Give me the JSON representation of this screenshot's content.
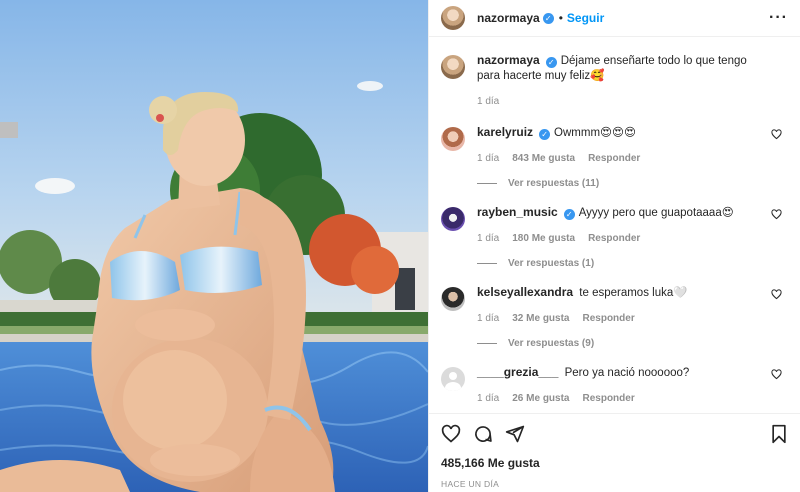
{
  "header": {
    "username": "nazormaya",
    "separator": "•",
    "follow_label": "Seguir",
    "more_label": "···"
  },
  "caption": {
    "username": "nazormaya",
    "text": "Déjame enseñarte todo lo que tengo para hacerte muy feliz🥰",
    "time": "1 día"
  },
  "comments": [
    {
      "username": "karelyruiz",
      "verified": true,
      "text": "Owmmm😍😍😍",
      "time": "1 día",
      "likes": "843 Me gusta",
      "reply_label": "Responder",
      "view_replies": "Ver respuestas (11)"
    },
    {
      "username": "rayben_music",
      "verified": true,
      "text": "Ayyyy pero que guapotaaaa😍",
      "time": "1 día",
      "likes": "180 Me gusta",
      "reply_label": "Responder",
      "view_replies": "Ver respuestas (1)"
    },
    {
      "username": "kelseyallexandra",
      "verified": false,
      "text": "te esperamos luka🤍",
      "time": "1 día",
      "likes": "32 Me gusta",
      "reply_label": "Responder",
      "view_replies": "Ver respuestas (9)"
    },
    {
      "username": "____grezia___",
      "verified": false,
      "text": "Pero ya nació noooooo?",
      "time": "1 día",
      "likes": "26 Me gusta",
      "reply_label": "Responder"
    }
  ],
  "footer": {
    "likes": "485,166 Me gusta",
    "time_ago": "HACE UN DÍA"
  },
  "icons": {
    "like": "heart-icon",
    "comment": "comment-icon",
    "share": "share-icon",
    "save": "bookmark-icon",
    "verified": "verified-badge-icon"
  },
  "colors": {
    "accent": "#0095f6",
    "verified": "#3897f0",
    "muted": "#8e8e8e",
    "text": "#262626",
    "border": "#efefef"
  }
}
